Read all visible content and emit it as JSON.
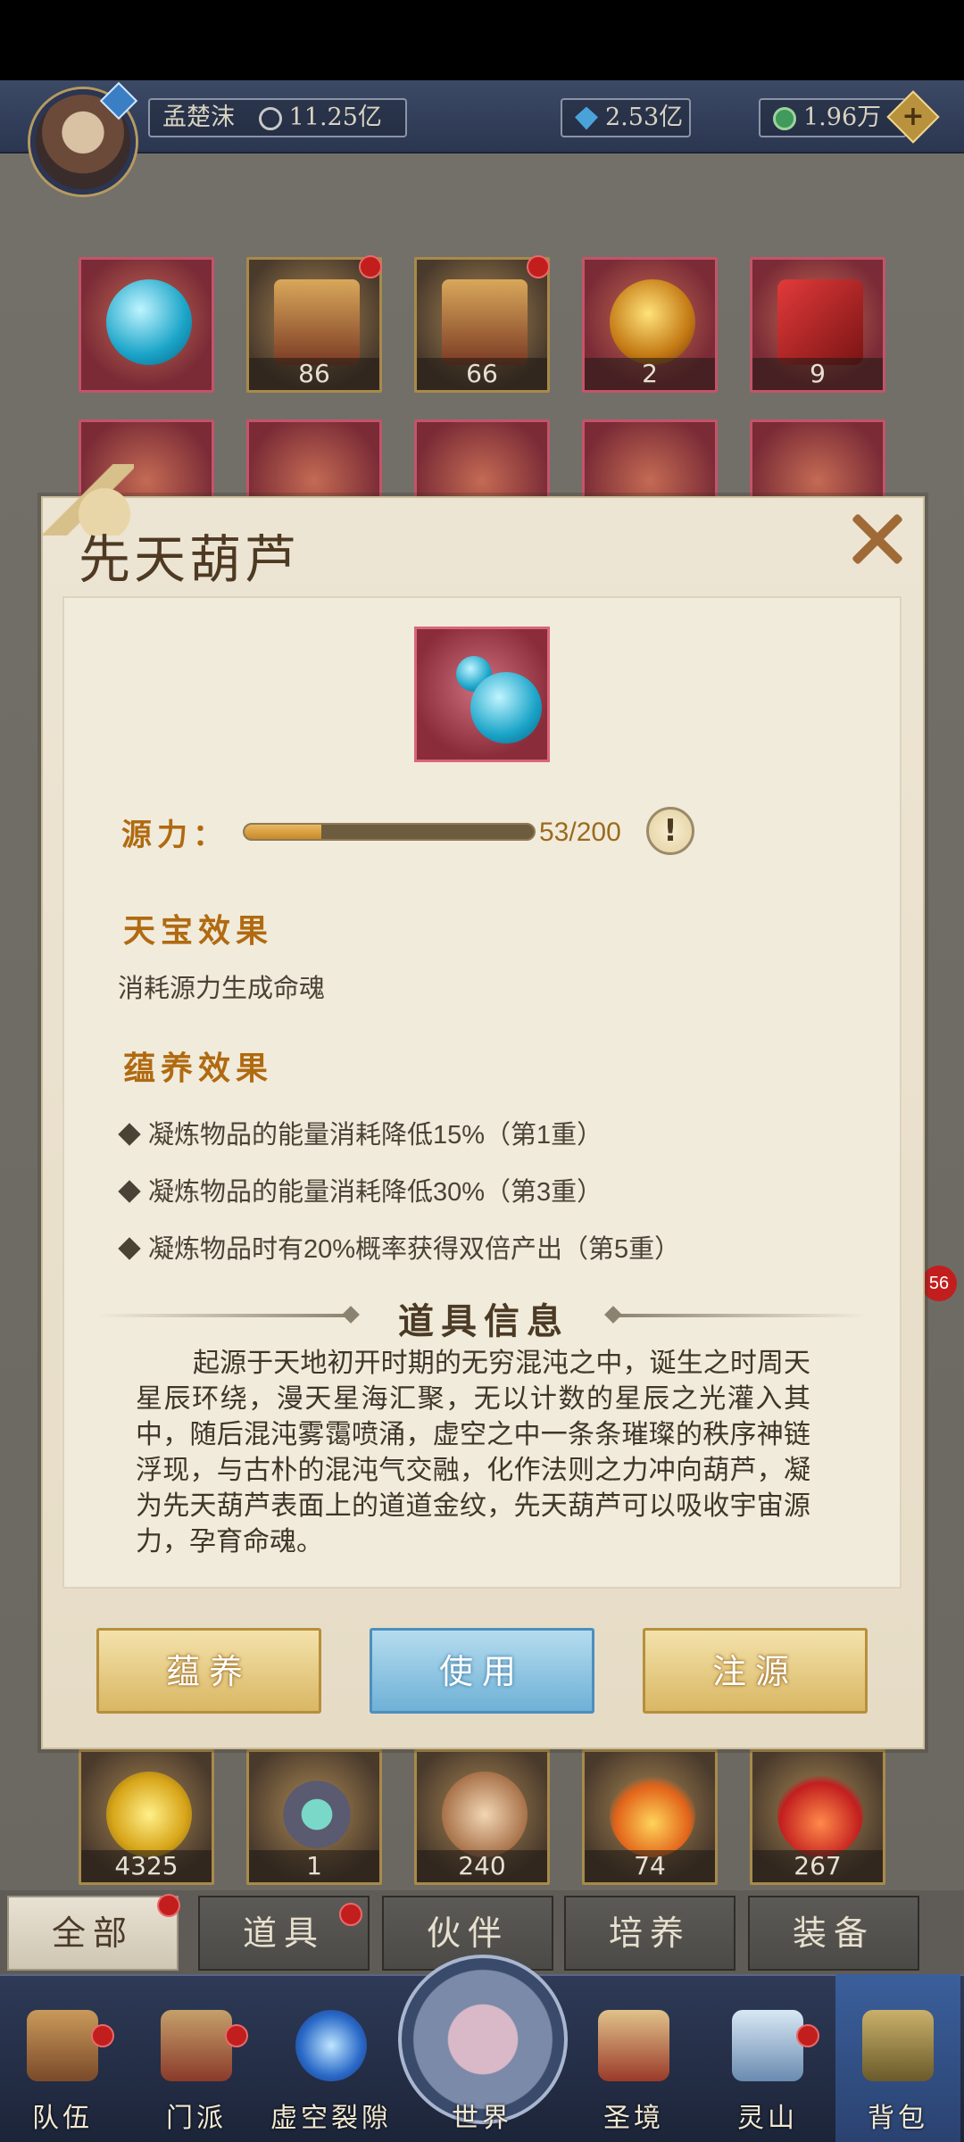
{
  "header": {
    "player_name": "孟楚沫",
    "power": "11.25亿",
    "gems": "2.53亿",
    "coins": "1.96万",
    "plus_label": "+"
  },
  "inventory_top": [
    {
      "name": "gourd",
      "count": ""
    },
    {
      "name": "chest",
      "count": "86"
    },
    {
      "name": "chest",
      "count": "66"
    },
    {
      "name": "flask",
      "count": "2"
    },
    {
      "name": "scroll",
      "count": "9"
    }
  ],
  "inventory_bottom": [
    {
      "name": "flower",
      "count": "4325"
    },
    {
      "name": "ring",
      "count": "1"
    },
    {
      "name": "feather",
      "count": "240"
    },
    {
      "name": "flame",
      "count": "74"
    },
    {
      "name": "drop",
      "count": "267"
    }
  ],
  "side_badge": "56",
  "dialog": {
    "title": "先天葫芦",
    "source_label": "源力：",
    "source_value": "53/200",
    "source_progress": 0.265,
    "info_icon": "!",
    "effect_title": "天宝效果",
    "effect_text": "消耗源力生成命魂",
    "nurture_title": "蕴养效果",
    "nurture_items": [
      "凝炼物品的能量消耗降低15%（第1重）",
      "凝炼物品的能量消耗降低30%（第3重）",
      "凝炼物品时有20%概率获得双倍产出（第5重）"
    ],
    "info_title": "道具信息",
    "description": "起源于天地初开时期的无穷混沌之中，诞生之时周天星辰环绕，漫天星海汇聚，无以计数的星辰之光灌入其中，随后混沌雾霭喷涌，虚空之中一条条璀璨的秩序神链浮现，与古朴的混沌气交融，化作法则之力冲向葫芦，凝为先天葫芦表面上的道道金纹，先天葫芦可以吸收宇宙源力，孕育命魂。",
    "buttons": {
      "nurture": "蕴养",
      "use": "使用",
      "inject": "注源"
    }
  },
  "tabs": [
    "全部",
    "道具",
    "伙伴",
    "培养",
    "装备"
  ],
  "nav": [
    "队伍",
    "门派",
    "虚空裂隙",
    "世界",
    "圣境",
    "灵山",
    "背包"
  ],
  "colors": {
    "accent_gold": "#b06a10",
    "use_blue": "#6fb1d6",
    "badge_red": "#c21e1e"
  }
}
